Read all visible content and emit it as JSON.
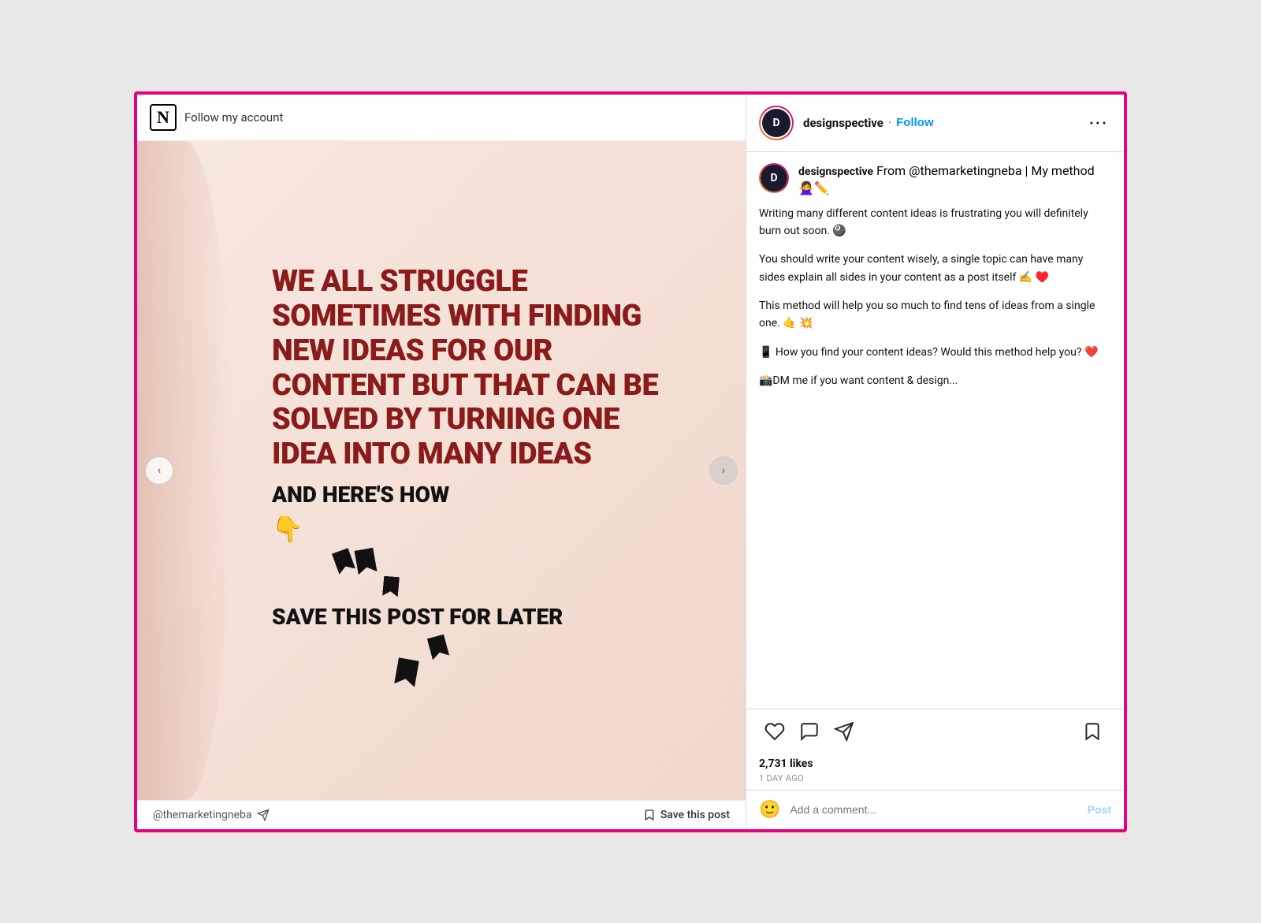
{
  "app": {
    "border_color": "#e8007d"
  },
  "top_bar": {
    "logo": "N",
    "text": "Follow my account"
  },
  "post": {
    "main_text": "WE ALL STRUGGLE SOMETIMES WITH FINDING NEW IDEAS FOR OUR CONTENT BUT THAT CAN BE SOLVED BY TURNING ONE IDEA INTO MANY IDEAS",
    "sub_text": "AND HERE'S HOW",
    "emoji_point": "👇",
    "save_text": "SAVE THIS POST FOR LATER"
  },
  "bottom_bar": {
    "handle": "@themarketingneba",
    "send_icon": "send",
    "save_label": "Save this post",
    "bookmark_icon": "bookmark"
  },
  "right_panel": {
    "username": "designspective",
    "follow_label": "Follow",
    "dot": "·",
    "more_label": "···",
    "avatar_initials": "D",
    "caption": {
      "username": "designspective",
      "from_text": "From @themarketingneba | My method 🙅‍♀️✏️",
      "paragraphs": [
        "Writing many different content ideas is frustrating you will definitely burn out soon. 🎱",
        "You should write your content wisely, a single topic can have many sides explain all sides in your content as a post itself ✍️ ♥️",
        "This method will help you so much to find tens of ideas from a single one. 🤙\n💥",
        "📱 How you find your content ideas? Would this method help you? ❤️",
        "📸DM me if you want content & design..."
      ]
    },
    "actions": {
      "like_icon": "heart",
      "comment_icon": "comment",
      "share_icon": "share",
      "save_icon": "bookmark"
    },
    "likes_count": "2,731 likes",
    "time_ago": "1 DAY AGO",
    "comment_placeholder": "Add a comment...",
    "post_label": "Post",
    "emoji_btn": "🙂"
  }
}
